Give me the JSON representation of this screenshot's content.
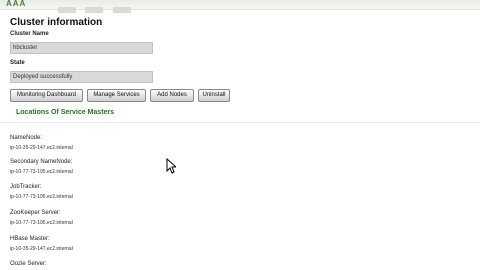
{
  "header": {
    "logo_text": "AAA"
  },
  "page_title": "Cluster information",
  "fields": {
    "cluster_name_label": "Cluster Name",
    "cluster_name_value": "hbcluster",
    "state_label": "State",
    "state_value": "Deployed successfully"
  },
  "actions": {
    "monitoring": "Monitoring Dashboard",
    "manage": "Manage Services",
    "add_nodes": "Add Nodes",
    "uninstall": "Uninstall"
  },
  "locations": {
    "title": "Locations Of Service Masters",
    "masters": [
      {
        "label": "NameNode:",
        "host": "ip-10-35-29-147.ec2.internal"
      },
      {
        "label": "Secondary NameNode:",
        "host": "ip-10-77-73-195.ec2.internal"
      },
      {
        "label": "JobTracker:",
        "host": "ip-10-77-73-195.ec2.internal"
      },
      {
        "label": "ZooKeeper Server:",
        "host": "ip-10-77-73-195.ec2.internal"
      },
      {
        "label": "HBase Master:",
        "host": "ip-10-35-29-147.ec2.internal"
      },
      {
        "label": "Oozie Server:",
        "host": ""
      }
    ]
  }
}
